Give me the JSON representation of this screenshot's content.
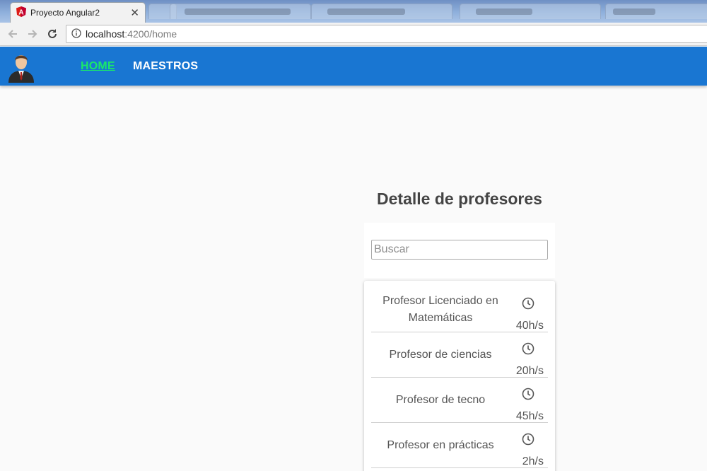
{
  "browser": {
    "active_tab_title": "Proyecto Angular2",
    "url_host": "localhost",
    "url_path": ":4200/home"
  },
  "nav": {
    "home_label": "HOME",
    "maestros_label": "MAESTROS"
  },
  "main": {
    "title": "Detalle de profesores",
    "search_placeholder": "Buscar",
    "professors": [
      {
        "name": "Profesor Licenciado en Matemáticas",
        "hours": "40h/s"
      },
      {
        "name": "Profesor de ciencias",
        "hours": "20h/s"
      },
      {
        "name": "Profesor de tecno",
        "hours": "45h/s"
      },
      {
        "name": "Profesor en prácticas",
        "hours": "2h/s"
      }
    ]
  },
  "colors": {
    "appbar": "#1976d2",
    "active_link": "#19e86a",
    "background": "#fafafa"
  },
  "icons": [
    "angular-favicon",
    "back-arrow-icon",
    "forward-arrow-icon",
    "reload-icon",
    "info-icon",
    "avatar",
    "clock-icon"
  ]
}
